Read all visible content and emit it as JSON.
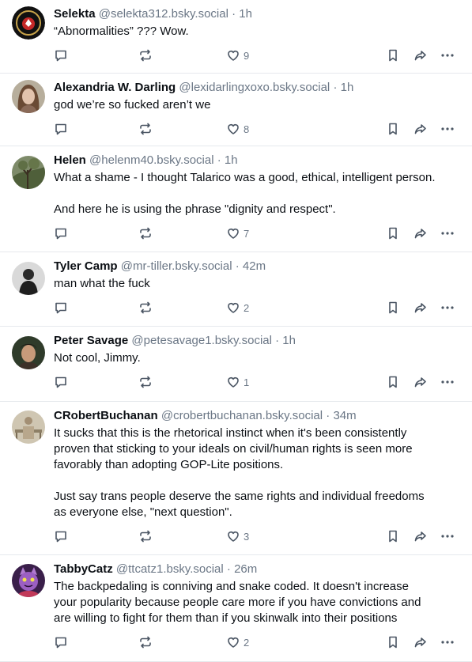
{
  "posts": [
    {
      "name": "Selekta",
      "handle": "@selekta312.bsky.social",
      "time": "1h",
      "text": "“Abnormalities” ??? Wow.",
      "likes": "9"
    },
    {
      "name": "Alexandria W. Darling",
      "handle": "@lexidarlingxoxo.bsky.social",
      "time": "1h",
      "text": "god we’re so fucked aren’t we",
      "likes": "8"
    },
    {
      "name": "Helen",
      "handle": "@helenm40.bsky.social",
      "time": "1h",
      "text": "What a shame - I thought Talarico was a good, ethical, intelligent person.\n\nAnd here he is using the phrase \"dignity and respect\".",
      "likes": "7"
    },
    {
      "name": "Tyler Camp",
      "handle": "@mr-tiller.bsky.social",
      "time": "42m",
      "text": "man what the fuck",
      "likes": "2"
    },
    {
      "name": "Peter Savage",
      "handle": "@petesavage1.bsky.social",
      "time": "1h",
      "text": "Not cool, Jimmy.",
      "likes": "1"
    },
    {
      "name": "CRobertBuchanan",
      "handle": "@crobertbuchanan.bsky.social",
      "time": "34m",
      "text": "It sucks that this is the rhetorical instinct when it's been consistently\nproven that sticking to your ideals on civil/human rights is seen more\nfavorably than adopting GOP-Lite positions.\n\nJust say trans people deserve the same rights and individual freedoms\nas everyone else, \"next question\".",
      "likes": "3"
    },
    {
      "name": "TabbyCatz",
      "handle": "@ttcatz1.bsky.social",
      "time": "26m",
      "text": "The backpedaling is conniving and snake coded. It doesn't increase\nyour popularity because people care more if you have convictions and\nare willing to fight for them than if you skinwalk into their positions",
      "likes": "2"
    }
  ],
  "separator": "·",
  "colors": {
    "text": "#0b0f14",
    "muted": "#6b7786",
    "border": "#e6e9ed"
  },
  "icons": {
    "reply": "reply-icon",
    "repost": "repost-icon",
    "like": "heart-icon",
    "bookmark": "bookmark-icon",
    "share": "share-icon",
    "more": "more-icon"
  }
}
